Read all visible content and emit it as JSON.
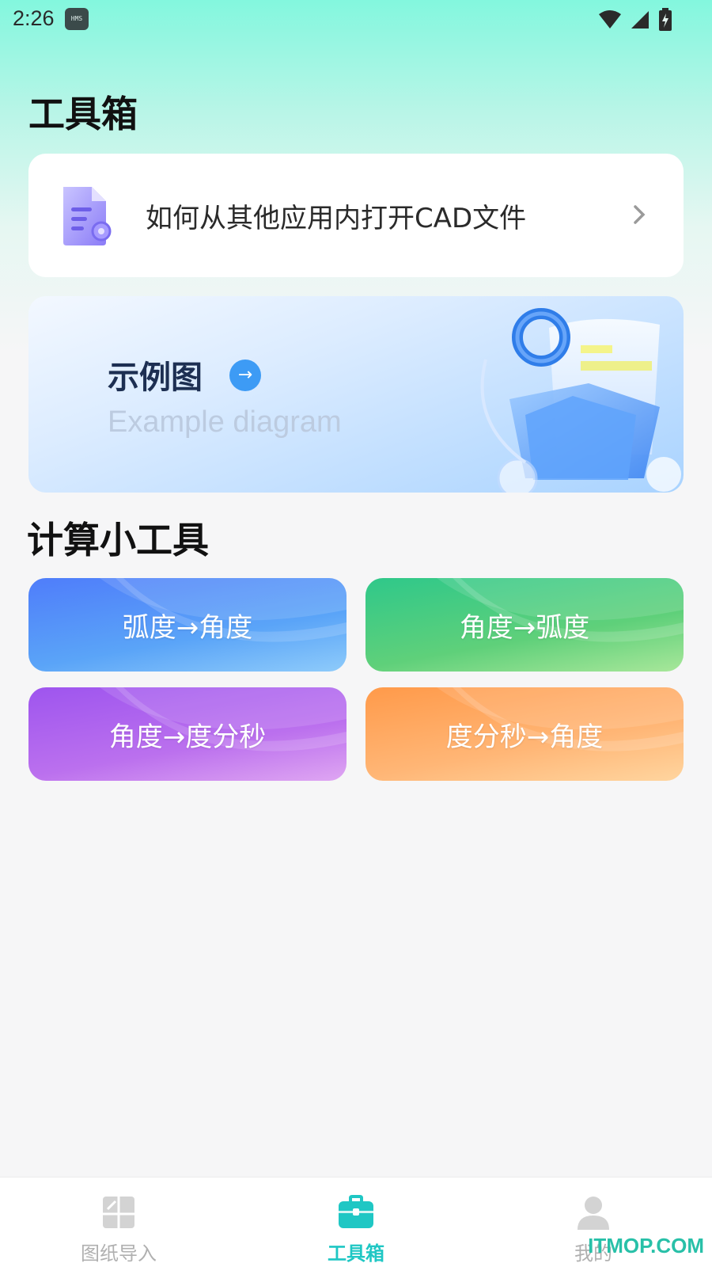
{
  "status_bar": {
    "time": "2:26",
    "badge": "HMS",
    "icons": [
      "wifi-icon",
      "signal-icon",
      "battery-charging-icon"
    ]
  },
  "page": {
    "title": "工具箱"
  },
  "help_card": {
    "icon": "document-icon",
    "text": "如何从其他应用内打开CAD文件",
    "chevron": "chevron-right-icon"
  },
  "banner": {
    "title": "示例图",
    "subtitle": "Example diagram",
    "arrow": "→"
  },
  "calc_section": {
    "title": "计算小工具",
    "tools": [
      {
        "label": "弧度→角度",
        "color": "#4f7dfa"
      },
      {
        "label": "角度→弧度",
        "color": "#2fc88a"
      },
      {
        "label": "角度→度分秒",
        "color": "#9e55ee"
      },
      {
        "label": "度分秒→角度",
        "color": "#ff9a4a"
      }
    ]
  },
  "bottom_nav": {
    "items": [
      {
        "label": "图纸导入",
        "icon": "drawing-import-icon",
        "active": false
      },
      {
        "label": "工具箱",
        "icon": "toolbox-icon",
        "active": true
      },
      {
        "label": "我的",
        "icon": "profile-icon",
        "active": false
      }
    ],
    "active_color": "#1fc7c4"
  },
  "watermark": "ITMOP.COM"
}
